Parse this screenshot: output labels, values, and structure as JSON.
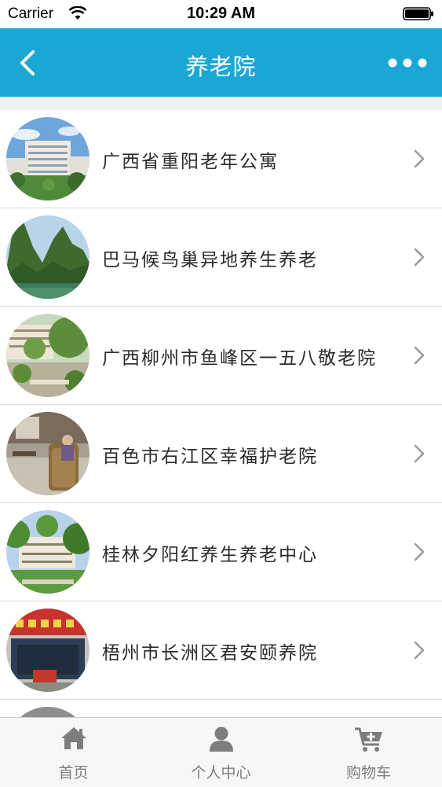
{
  "status_bar": {
    "carrier": "Carrier",
    "time": "10:29 AM"
  },
  "nav": {
    "title": "养老院"
  },
  "list": {
    "items": [
      {
        "label": "广西省重阳老年公寓"
      },
      {
        "label": "巴马候鸟巢异地养生养老"
      },
      {
        "label": "广西柳州市鱼峰区一五八敬老院"
      },
      {
        "label": "百色市右江区幸福护老院"
      },
      {
        "label": "桂林夕阳红养生养老中心"
      },
      {
        "label": "梧州市长洲区君安颐养院"
      }
    ]
  },
  "tabs": [
    {
      "label": "首页",
      "icon": "home-icon"
    },
    {
      "label": "个人中心",
      "icon": "user-icon"
    },
    {
      "label": "购物车",
      "icon": "cart-icon"
    }
  ],
  "colors": {
    "accent": "#1aa7d3",
    "tab_gray": "#7d7d7d"
  }
}
